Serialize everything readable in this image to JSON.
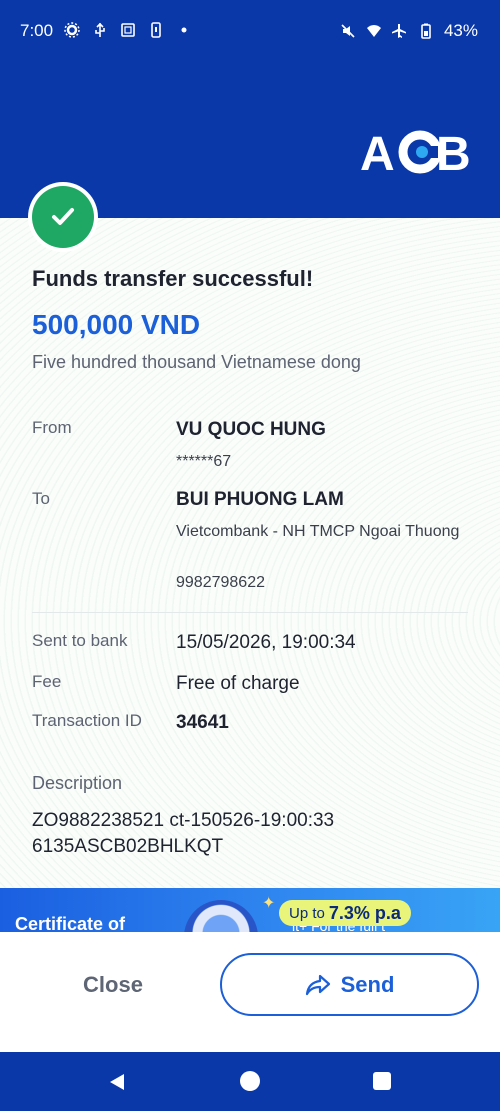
{
  "status_bar": {
    "time": "7:00",
    "battery": "43%",
    "left_icons": [
      "settings-icon",
      "usb-icon",
      "screenshot-icon",
      "phone-icon",
      "dot-icon"
    ],
    "right_icons": [
      "mute-icon",
      "wifi-icon",
      "airplane-icon",
      "battery-icon"
    ]
  },
  "brand": {
    "logo_text": "ACB",
    "accent_color": "#0b38a8"
  },
  "receipt": {
    "title": "Funds transfer successful!",
    "amount": "500,000 VND",
    "amount_words": "Five hundred thousand Vietnamese dong",
    "from_label": "From",
    "from_name": "VU QUOC HUNG",
    "from_account": "******67",
    "to_label": "To",
    "to_name": "BUI PHUONG LAM",
    "to_bank": "Vietcombank - NH TMCP Ngoai Thuong",
    "to_account": "9982798622",
    "sent_label": "Sent to bank",
    "sent_value": "15/05/2026, 19:00:34",
    "fee_label": "Fee",
    "fee_value": "Free of charge",
    "txn_label": "Transaction ID",
    "txn_value": "34641",
    "desc_label": "Description",
    "desc_value": "ZO9882238521 ct-150526-19:00:33 6135ASCB02BHLKQT"
  },
  "banner": {
    "title": "Certificate of",
    "rate_prefix": "Up to",
    "rate": "7.3% p.a",
    "tail": "it+ For the full t"
  },
  "actions": {
    "close_label": "Close",
    "send_label": "Send"
  },
  "colors": {
    "success": "#1fa863",
    "amount": "#1b5fd9",
    "header": "#0b38a8"
  }
}
